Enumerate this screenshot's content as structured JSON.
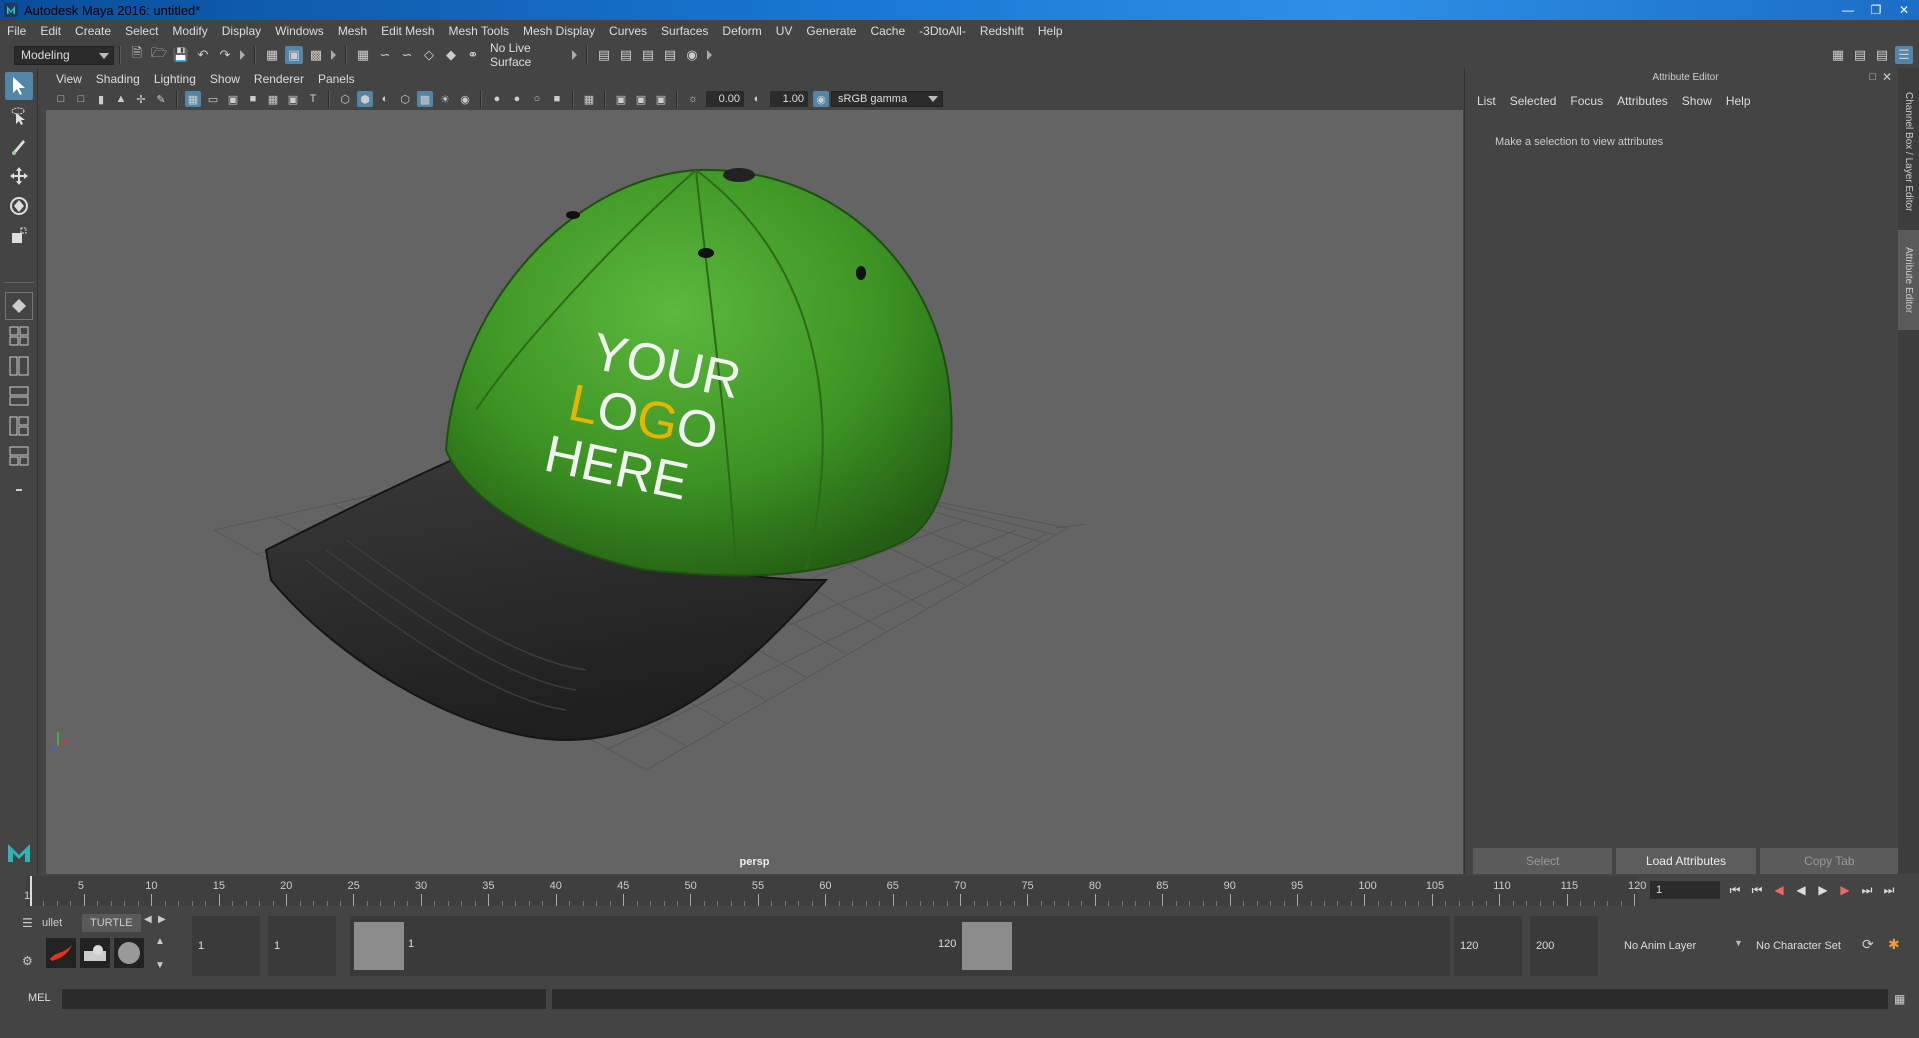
{
  "window": {
    "title": "Autodesk Maya 2016: untitled*"
  },
  "menubar": {
    "items": [
      "File",
      "Edit",
      "Create",
      "Select",
      "Modify",
      "Display",
      "Windows",
      "Mesh",
      "Edit Mesh",
      "Mesh Tools",
      "Mesh Display",
      "Curves",
      "Surfaces",
      "Deform",
      "UV",
      "Generate",
      "Cache",
      "-3DtoAll-",
      "Redshift",
      "Help"
    ]
  },
  "statusline": {
    "menuset": "Modeling",
    "live_surface": "No Live Surface"
  },
  "viewport": {
    "menus": [
      "View",
      "Shading",
      "Lighting",
      "Show",
      "Renderer",
      "Panels"
    ],
    "exposure": "0.00",
    "gamma": "1.00",
    "color_space": "sRGB gamma",
    "camera": "persp",
    "logo_text": {
      "line1": "YOUR",
      "line2_l": "L",
      "line2_o": "O",
      "line2_g": "G",
      "line2_o2": "O",
      "line3": "HERE"
    },
    "colors": {
      "cap_green": "#3f9a26",
      "brim_black": "#2a2a2a",
      "logo_yellow": "#e8b400",
      "grid": "#555555"
    }
  },
  "attribute_editor": {
    "title": "Attribute Editor",
    "menus": [
      "List",
      "Selected",
      "Focus",
      "Attributes",
      "Show",
      "Help"
    ],
    "hint": "Make a selection to view attributes",
    "buttons": {
      "select": "Select",
      "load": "Load Attributes",
      "copy": "Copy Tab"
    },
    "side_tabs": {
      "channel_box": "Channel Box / Layer Editor",
      "attribute_editor": "Attribute Editor"
    }
  },
  "timeslider": {
    "ticks": [
      "1",
      "5",
      "10",
      "15",
      "20",
      "25",
      "30",
      "35",
      "40",
      "45",
      "50",
      "55",
      "60",
      "65",
      "70",
      "75",
      "80",
      "85",
      "90",
      "95",
      "100",
      "105",
      "110",
      "115",
      "120"
    ],
    "current_frame": "1"
  },
  "rangeslider": {
    "shelf_tabs": [
      "ullet",
      "TURTLE"
    ],
    "start_time": "1",
    "playback_start": "1",
    "range_start": "1",
    "range_end": "120",
    "playback_end": "120",
    "end_time": "200",
    "anim_layer": "No Anim Layer",
    "character_set": "No Character Set"
  },
  "cmdline": {
    "label": "MEL"
  }
}
